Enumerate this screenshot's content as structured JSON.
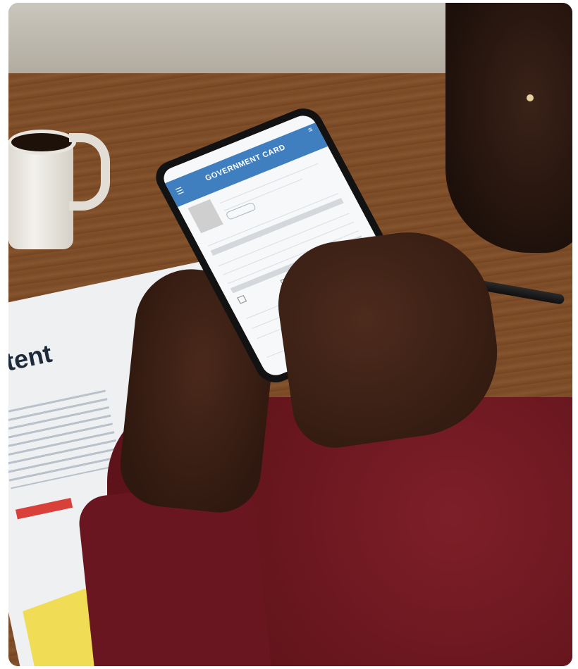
{
  "photo": {
    "subject": "person-holding-phone-with-government-form",
    "phone_app": {
      "header_title": "GOVERNMENT CARD"
    },
    "document_on_table": {
      "headline_fragment": "stent"
    },
    "colors": {
      "header_blue": "#3f7fc0",
      "sweater_maroon": "#6a1620",
      "table_wood": "#7a4926",
      "highlight_yellow": "#f0dc55",
      "highlight_red": "#d9403a"
    }
  }
}
